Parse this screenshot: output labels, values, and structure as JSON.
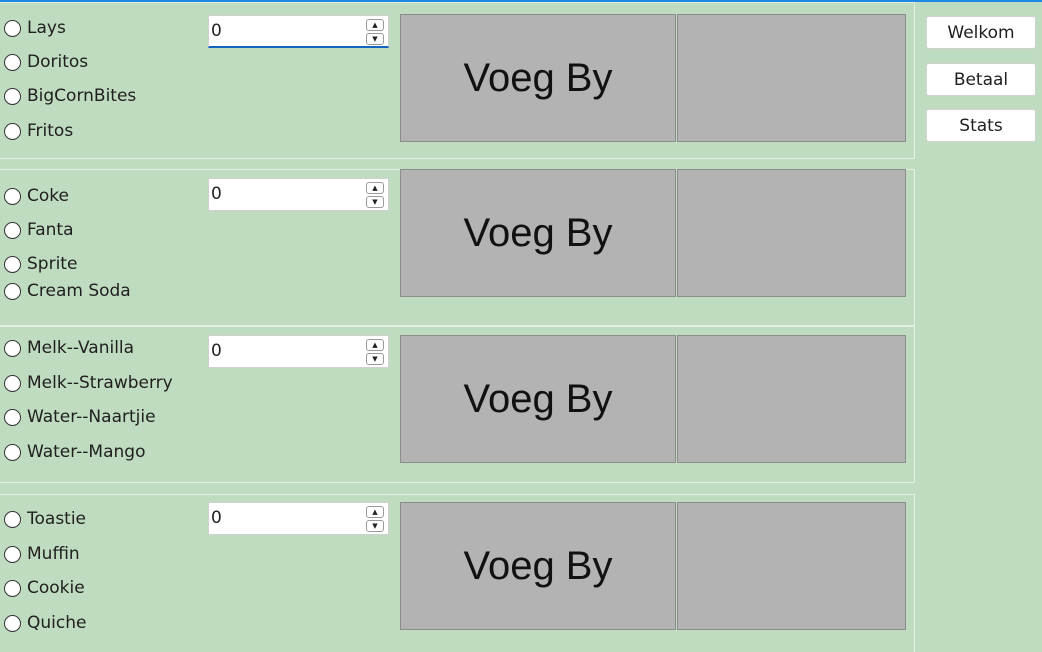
{
  "groups": [
    {
      "options": [
        "Lays",
        "Doritos",
        "BigCornBites",
        "Fritos"
      ],
      "quantity": "0",
      "add_label": "Voeg By"
    },
    {
      "options": [
        "Coke",
        "Fanta",
        "Sprite",
        "Cream Soda"
      ],
      "quantity": "0",
      "add_label": "Voeg By"
    },
    {
      "options": [
        "Melk--Vanilla",
        "Melk--Strawberry",
        "Water--Naartjie",
        "Water--Mango"
      ],
      "quantity": "0",
      "add_label": "Voeg By"
    },
    {
      "options": [
        "Toastie",
        "Muffin",
        "Cookie",
        "Quiche"
      ],
      "quantity": "0",
      "add_label": "Voeg By"
    }
  ],
  "nav": {
    "welcome": "Welkom",
    "pay": "Betaal",
    "stats": "Stats"
  },
  "colors": {
    "background": "#c0dcc0",
    "tile": "#b3b3b3",
    "focus": "#1565c0"
  }
}
